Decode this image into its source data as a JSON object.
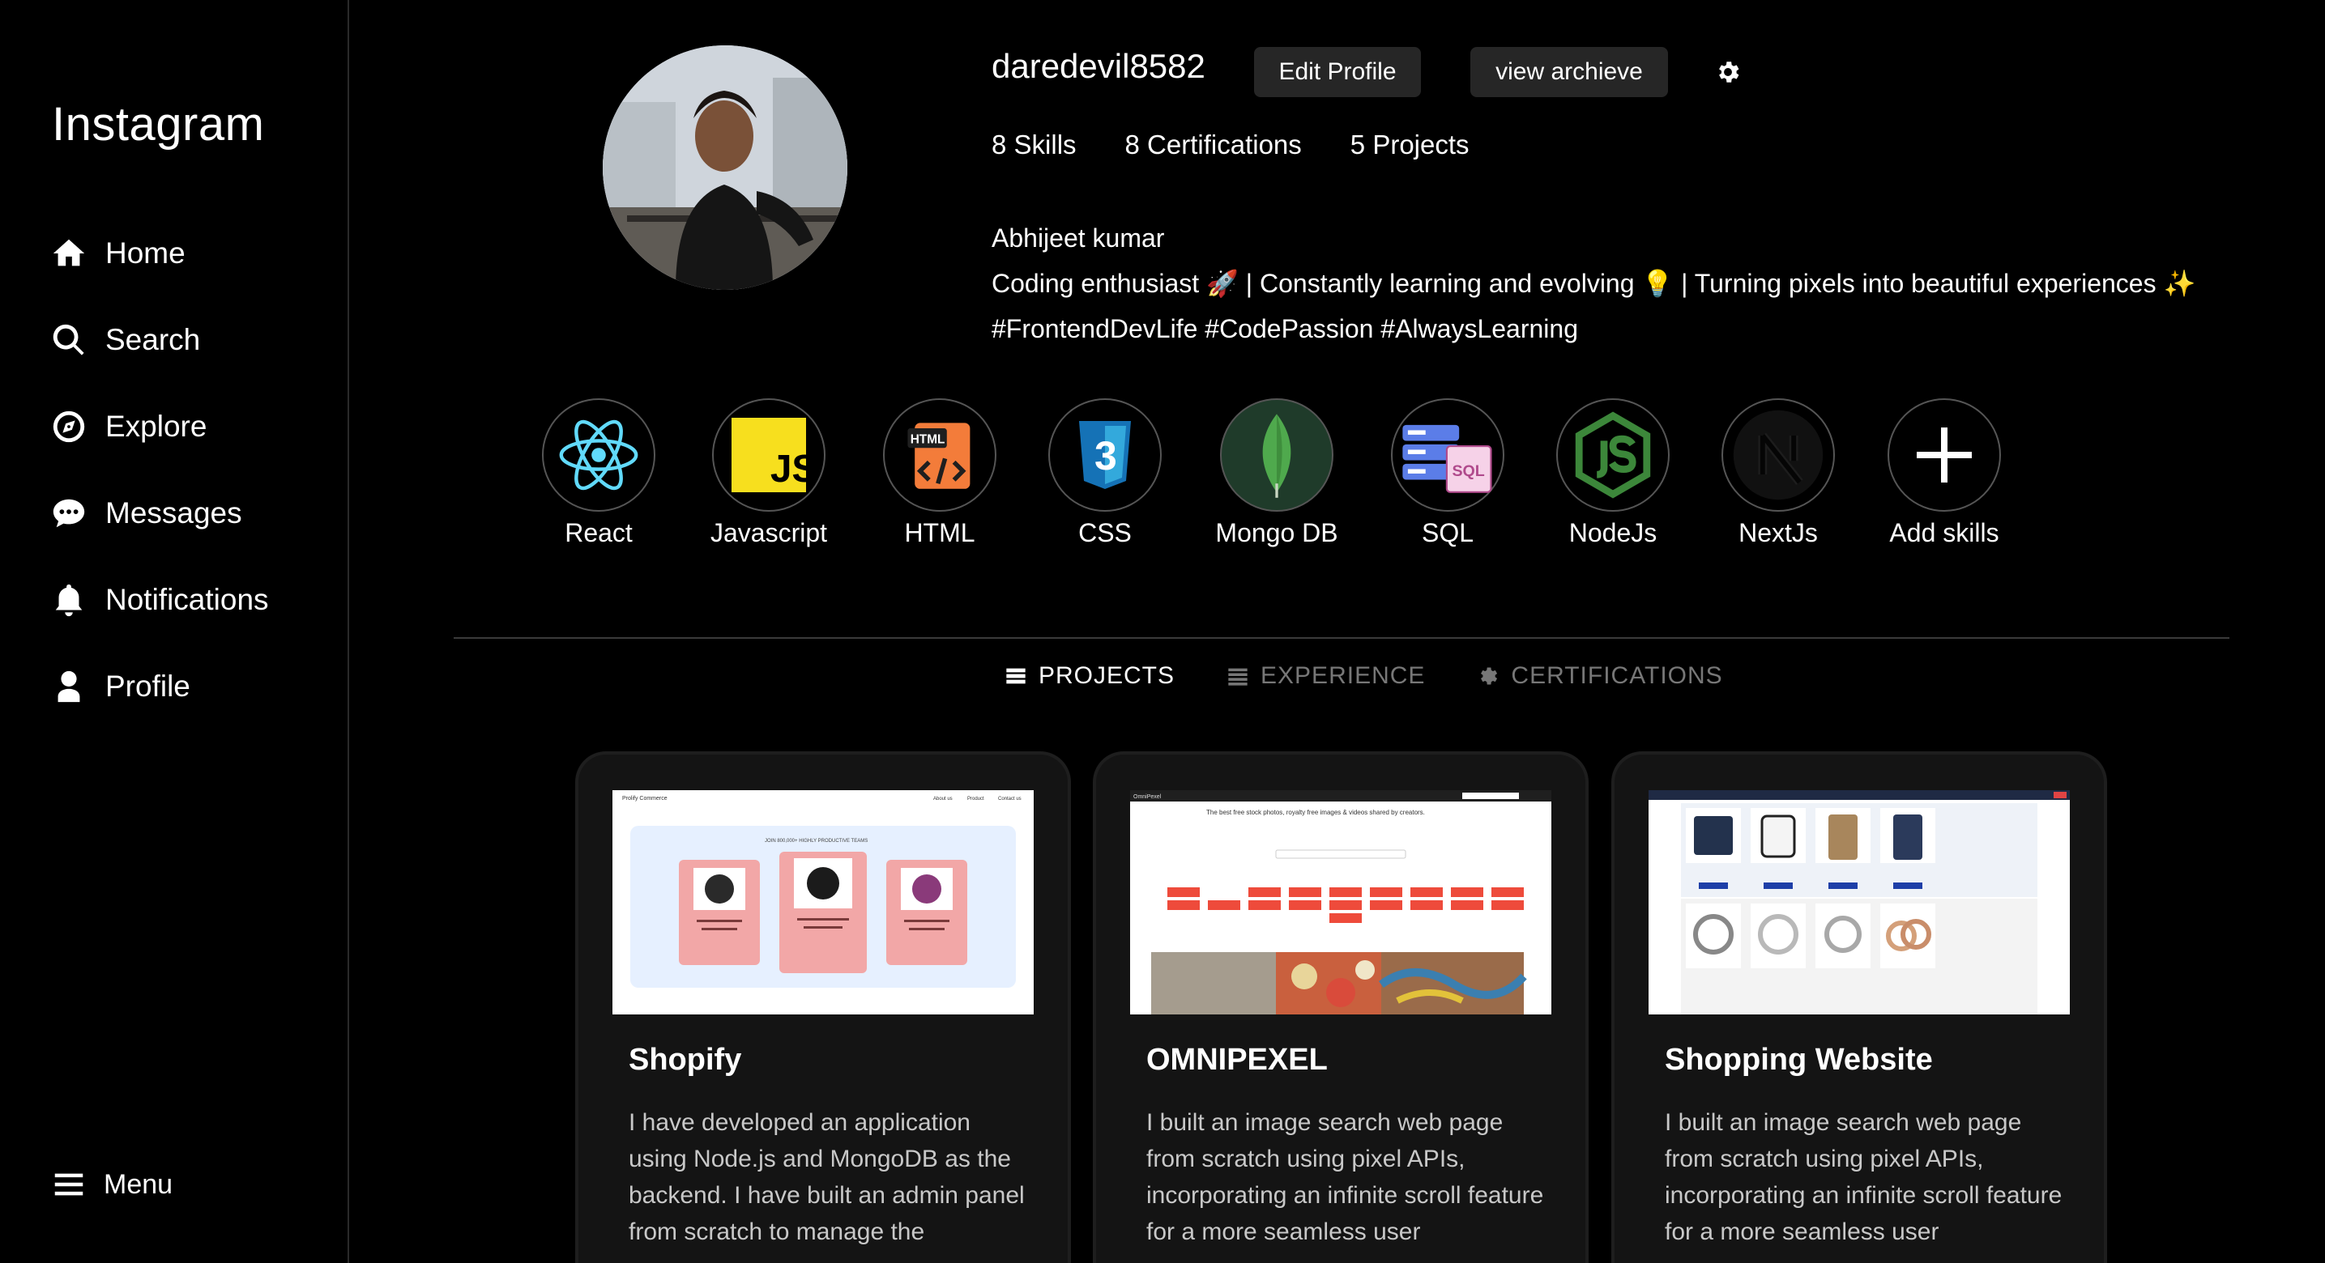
{
  "sidebar": {
    "brand": "Instagram",
    "items": [
      {
        "label": "Home",
        "icon": "home-icon"
      },
      {
        "label": "Search",
        "icon": "search-icon"
      },
      {
        "label": "Explore",
        "icon": "compass-icon"
      },
      {
        "label": "Messages",
        "icon": "chat-bubble-icon"
      },
      {
        "label": "Notifications",
        "icon": "bell-icon"
      },
      {
        "label": "Profile",
        "icon": "user-icon"
      }
    ],
    "menu_label": "Menu"
  },
  "profile": {
    "username": "daredevil8582",
    "edit_label": "Edit Profile",
    "archive_label": "view archieve",
    "stats": [
      "8 Skills",
      "8 Certifications",
      "5 Projects"
    ],
    "name": "Abhijeet kumar",
    "bio": "Coding enthusiast 🚀 | Constantly learning and evolving 💡 | Turning pixels into beautiful experiences ✨",
    "tags": "#FrontendDevLife #CodePassion #AlwaysLearning"
  },
  "skills": [
    {
      "label": "React",
      "icon": "react-icon"
    },
    {
      "label": "Javascript",
      "icon": "javascript-icon"
    },
    {
      "label": "HTML",
      "icon": "html-icon"
    },
    {
      "label": "CSS",
      "icon": "css-icon"
    },
    {
      "label": "Mongo DB",
      "icon": "mongodb-icon"
    },
    {
      "label": "SQL",
      "icon": "sql-icon"
    },
    {
      "label": "NodeJs",
      "icon": "nodejs-icon"
    },
    {
      "label": "NextJs",
      "icon": "nextjs-icon"
    },
    {
      "label": "Add skills",
      "icon": "plus-icon"
    }
  ],
  "tabs": [
    {
      "label": "PROJECTS",
      "active": true
    },
    {
      "label": "EXPERIENCE",
      "active": false
    },
    {
      "label": "CERTIFICATIONS",
      "active": false
    }
  ],
  "icon_text": {
    "js": "JS",
    "html": "HTML",
    "css": "3",
    "sql": "SQL"
  },
  "projects": [
    {
      "title": "Shopify",
      "description": "I have developed an application using Node.js and MongoDB as the backend. I have built an admin panel from scratch to manage the",
      "thumb": {
        "brand": "Prolify Commerce",
        "heading": "JOIN 800,000+ HIGHLY PRODUCTIVE TEAMS",
        "nav": [
          "About us",
          "Product",
          "Contact us"
        ]
      }
    },
    {
      "title": "OMNIPEXEL",
      "description": "I built an image search web page from scratch using pixel APIs, incorporating an infinite scroll feature for a more seamless user",
      "thumb": {
        "brand": "OmniPexel",
        "heading": "The best free stock photos, royalty free images & videos shared by creators."
      }
    },
    {
      "title": "Shopping Website",
      "description": "I built an image search web page from scratch using pixel APIs, incorporating an infinite scroll feature for a more seamless user",
      "thumb": {}
    }
  ],
  "colors": {
    "background": "#000000",
    "card": "#141414",
    "button": "#262626",
    "muted": "#777777"
  }
}
